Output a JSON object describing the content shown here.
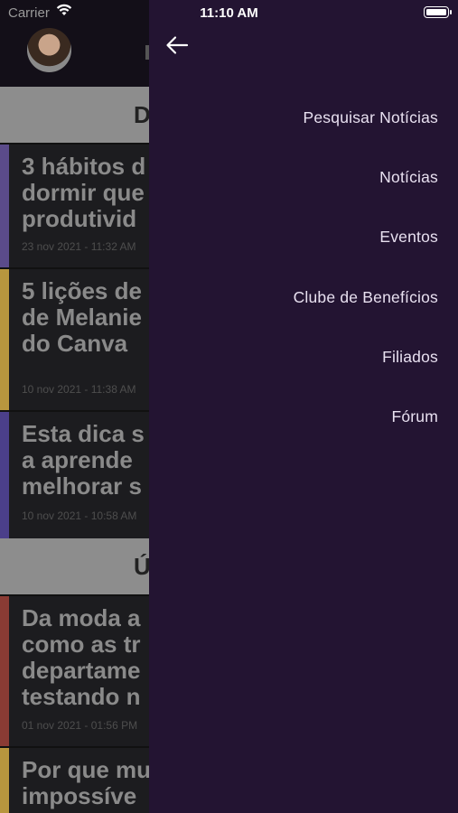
{
  "status_bar": {
    "carrier": "Carrier",
    "time": "11:10 AM"
  },
  "background": {
    "sections": [
      {
        "label": "D"
      },
      {
        "label": "Ú"
      }
    ],
    "articles": [
      {
        "title": "3 hábitos d\ndormir que\nprodutivid",
        "date": "23 nov 2021 - 11:32 AM",
        "color": "#5b4b8a"
      },
      {
        "title": "5 lições de\nde Melanie\ndo Canva",
        "date": "10 nov 2021 - 11:38 AM",
        "color": "#b8963e"
      },
      {
        "title": "Esta dica s\na aprende\nmelhorar s",
        "date": "10 nov 2021 - 10:58 AM",
        "color": "#4b3f8a"
      },
      {
        "title": "Da moda a\ncomo as tr\ndepartame\ntestando n",
        "date": "01 nov 2021 - 01:56 PM",
        "color": "#8a3b34"
      },
      {
        "title": "Por que mu\nimpossíve",
        "date": "",
        "color": "#b8963e"
      }
    ]
  },
  "drawer": {
    "back_icon": "arrow-left-icon",
    "menu": [
      {
        "label": "Pesquisar Notícias"
      },
      {
        "label": "Notícias"
      },
      {
        "label": "Eventos"
      },
      {
        "label": "Clube de Benefícios"
      },
      {
        "label": "Filiados"
      },
      {
        "label": "Fórum"
      }
    ]
  },
  "colors": {
    "drawer_bg": "#231432",
    "menu_text": "#e8e0f0"
  }
}
